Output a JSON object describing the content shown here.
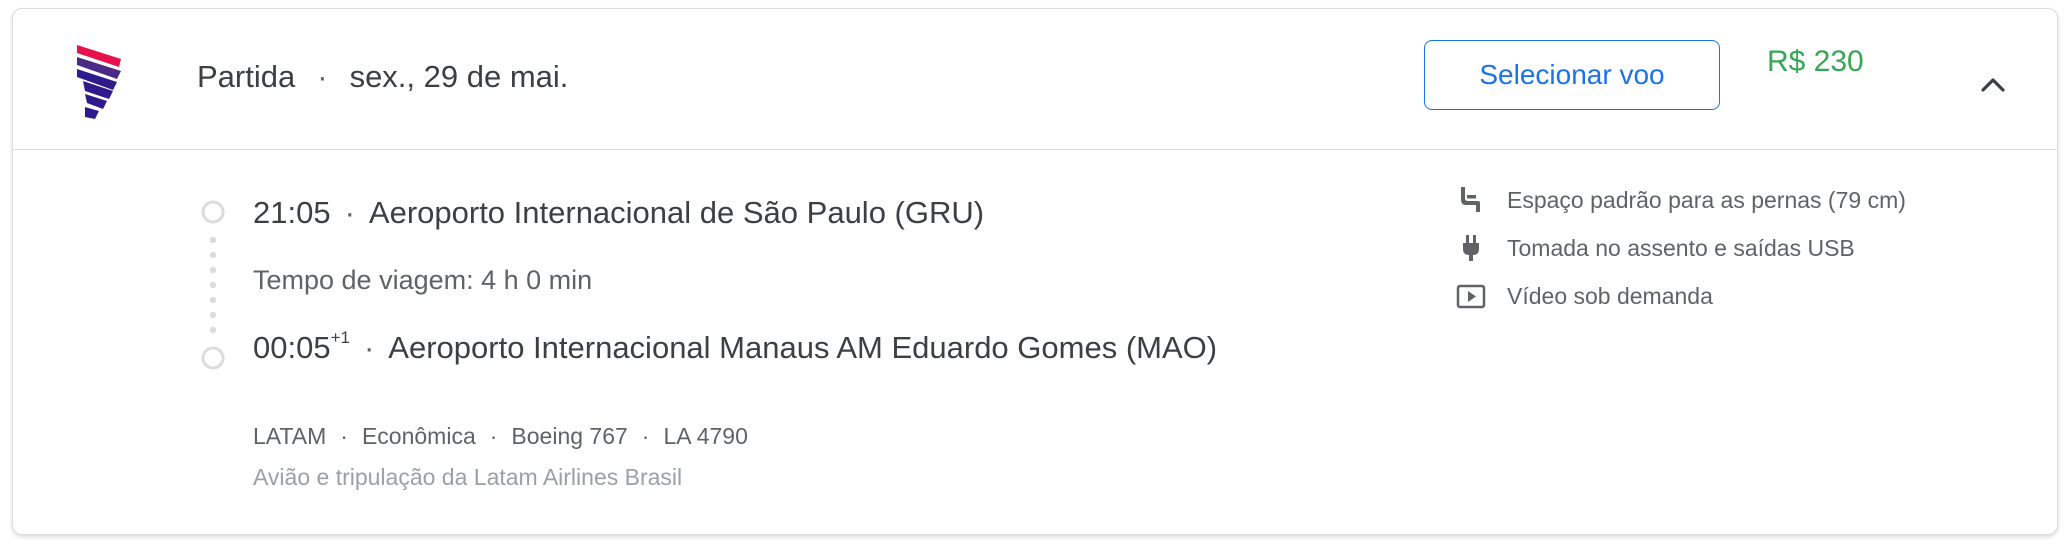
{
  "header": {
    "airline_logo": "latam-logo",
    "direction": "Partida",
    "separator": "·",
    "date": "sex., 29 de mai.",
    "select_label": "Selecionar voo",
    "price": "R$ 230",
    "toggle_icon": "chevron-up-icon"
  },
  "itinerary": {
    "departure": {
      "time": "21:05",
      "airport": "Aeroporto Internacional de São Paulo (GRU)"
    },
    "travel_time": "Tempo de viagem: 4 h 0 min",
    "arrival": {
      "time": "00:05",
      "day_offset": "+1",
      "airport": "Aeroporto Internacional Manaus AM Eduardo Gomes (MAO)"
    },
    "dot": "·"
  },
  "details": {
    "airline": "LATAM",
    "cabin": "Econômica",
    "aircraft": "Boeing 767",
    "flight_number": "LA 4790",
    "operator": "Avião e tripulação da Latam Airlines Brasil"
  },
  "amenities": [
    {
      "icon": "legroom-seat-icon",
      "label": "Espaço padrão para as pernas (79 cm)"
    },
    {
      "icon": "power-plug-icon",
      "label": "Tomada no assento e saídas USB"
    },
    {
      "icon": "video-play-icon",
      "label": "Vídeo sob demanda"
    }
  ],
  "colors": {
    "accent": "#1a73e8",
    "price": "#34a853",
    "text": "#3c4043",
    "muted": "#5f6368",
    "faint": "#9aa0a6"
  }
}
